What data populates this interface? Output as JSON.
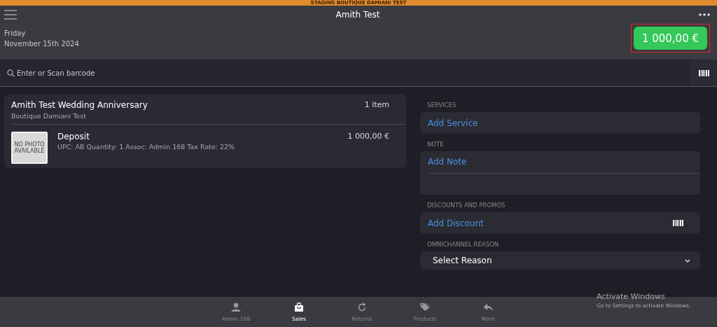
{
  "banner": {
    "text": "STAGING BOUTIQUE DAMIANI TEST"
  },
  "header": {
    "title": "Amith Test",
    "day": "Friday",
    "date": "November 15th 2024",
    "total": "1 000,00 €",
    "total_highlighted": true
  },
  "search": {
    "placeholder": "Enter or Scan barcode"
  },
  "order": {
    "title": "Amith Test Wedding Anniversary",
    "store": "Boutique Damiani Test",
    "count": "1 item",
    "items": [
      {
        "name": "Deposit",
        "details": "UPC: AB Quantity: 1 Assoc: Admin 168 Tax Rate: 22%",
        "price": "1 000,00 €",
        "photo_text": "NO PHOTO AVAILABLE"
      }
    ]
  },
  "sections": [
    {
      "kind": "action",
      "label": "SERVICES",
      "action": "Add Service"
    },
    {
      "kind": "note",
      "label": "NOTE",
      "action": "Add Note"
    },
    {
      "kind": "scan",
      "label": "DISCOUNTS AND PROMOS",
      "action": "Add Discount"
    },
    {
      "kind": "select",
      "label": "OMNICHANNEL REASON",
      "action": "Select Reason"
    }
  ],
  "tabs": [
    {
      "kind": "person",
      "label": "Admin 168",
      "selected": false
    },
    {
      "kind": "bag",
      "label": "Sales",
      "selected": true
    },
    {
      "kind": "refresh",
      "label": "Returns",
      "selected": false
    },
    {
      "kind": "tags",
      "label": "Products",
      "selected": false
    },
    {
      "kind": "reply",
      "label": "More",
      "selected": false
    }
  ],
  "activation": {
    "title": "Activate Windows",
    "hint": "Go to Settings to activate Windows."
  }
}
